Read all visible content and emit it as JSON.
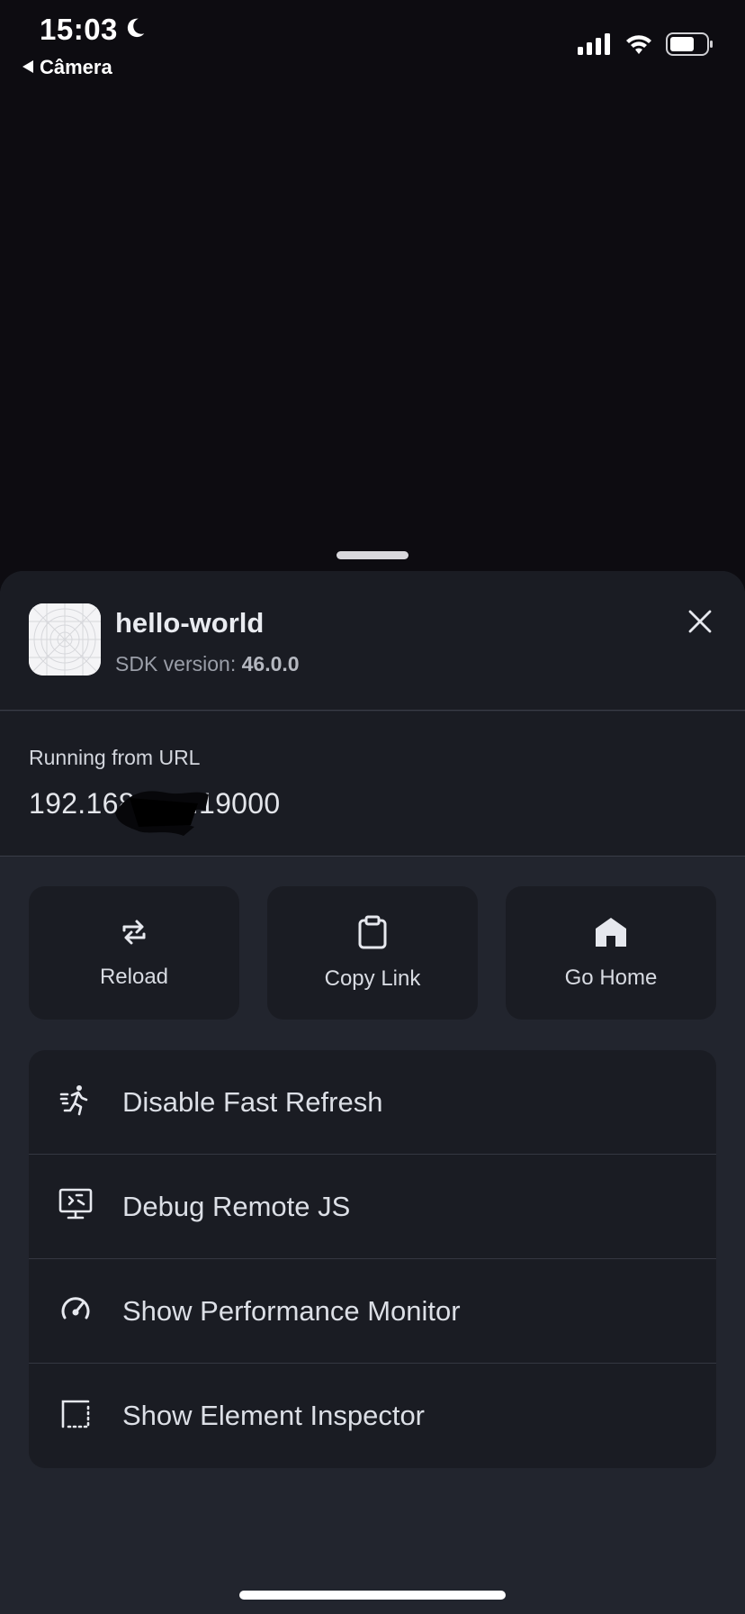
{
  "status_bar": {
    "time": "15:03",
    "back_label": "Câmera",
    "icons": [
      "moon-icon",
      "cellular-signal-icon",
      "wifi-icon",
      "battery-icon"
    ]
  },
  "sheet": {
    "app_name": "hello-world",
    "sdk_label": "SDK version:",
    "sdk_version": "46.0.0",
    "url_label": "Running from URL",
    "url_prefix": "192.168",
    "url_suffix": ":19000"
  },
  "actions": [
    {
      "label": "Reload",
      "icon": "reload-icon"
    },
    {
      "label": "Copy Link",
      "icon": "clipboard-icon"
    },
    {
      "label": "Go Home",
      "icon": "home-icon"
    }
  ],
  "menu": [
    {
      "label": "Disable Fast Refresh",
      "icon": "running-person-icon"
    },
    {
      "label": "Debug Remote JS",
      "icon": "debug-monitor-icon"
    },
    {
      "label": "Show Performance Monitor",
      "icon": "speedometer-icon"
    },
    {
      "label": "Show Element Inspector",
      "icon": "inspector-icon"
    }
  ],
  "colors": {
    "background": "#0d0c11",
    "sheet": "#22252e",
    "card": "#1a1c23",
    "text": "#dcdfe6",
    "muted": "#9a9ea8"
  }
}
